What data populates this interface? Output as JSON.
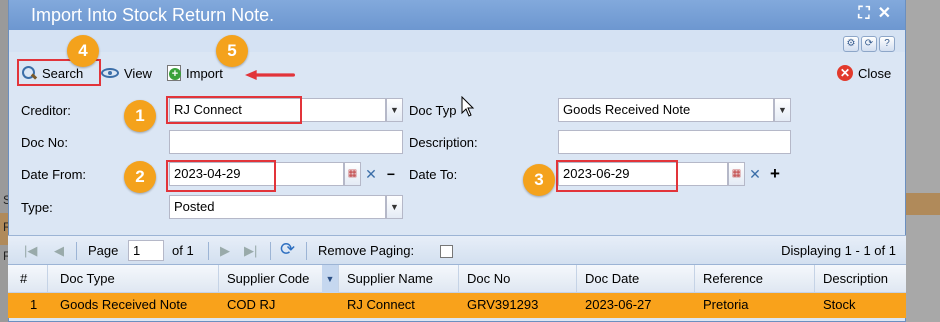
{
  "window": {
    "title": "Import Into Stock Return Note."
  },
  "title_icons": [
    "expand-icon",
    "close-icon"
  ],
  "mini_buttons": [
    "gear-icon",
    "refresh-icon",
    "help-icon"
  ],
  "toolbar": {
    "search": "Search",
    "view": "View",
    "import": "Import",
    "close": "Close"
  },
  "form": {
    "creditor_label": "Creditor:",
    "creditor_value": "RJ Connect",
    "doc_type_label": "Doc Typ",
    "doc_type_value": "Goods Received Note",
    "doc_no_label": "Doc No:",
    "doc_no_value": "",
    "description_label": "Description:",
    "description_value": "",
    "date_from_label": "Date From:",
    "date_from_value": "2023-04-29",
    "date_to_label": "Date To:",
    "date_to_value": "2023-06-29",
    "type_label": "Type:",
    "type_value": "Posted",
    "minus": "−",
    "plus": "+"
  },
  "badges": [
    "1",
    "2",
    "3",
    "4",
    "5"
  ],
  "pager": {
    "page_label": "Page",
    "page_value": "1",
    "of_label": "of 1",
    "remove_paging": "Remove Paging:",
    "remove_paging_checked": false,
    "displaying": "Displaying 1 - 1 of 1"
  },
  "grid": {
    "columns": [
      "#",
      "Doc Type",
      "Supplier Code",
      "Supplier Name",
      "Doc No",
      "Doc Date",
      "Reference",
      "Description"
    ],
    "rows": [
      {
        "num": "1",
        "doc_type": "Goods Received Note",
        "supplier_code": "COD RJ",
        "supplier_name": "RJ Connect",
        "doc_no": "GRV391293",
        "doc_date": "2023-06-27",
        "reference": "Pretoria",
        "description": "Stock"
      }
    ]
  },
  "background": {
    "left_texts": [
      "S",
      "R",
      "R"
    ]
  },
  "colors": {
    "title_bar": "#6d97d0",
    "selected_row": "#f9a21b",
    "badge": "#f4a21c",
    "highlight_box": "#e2343a"
  }
}
